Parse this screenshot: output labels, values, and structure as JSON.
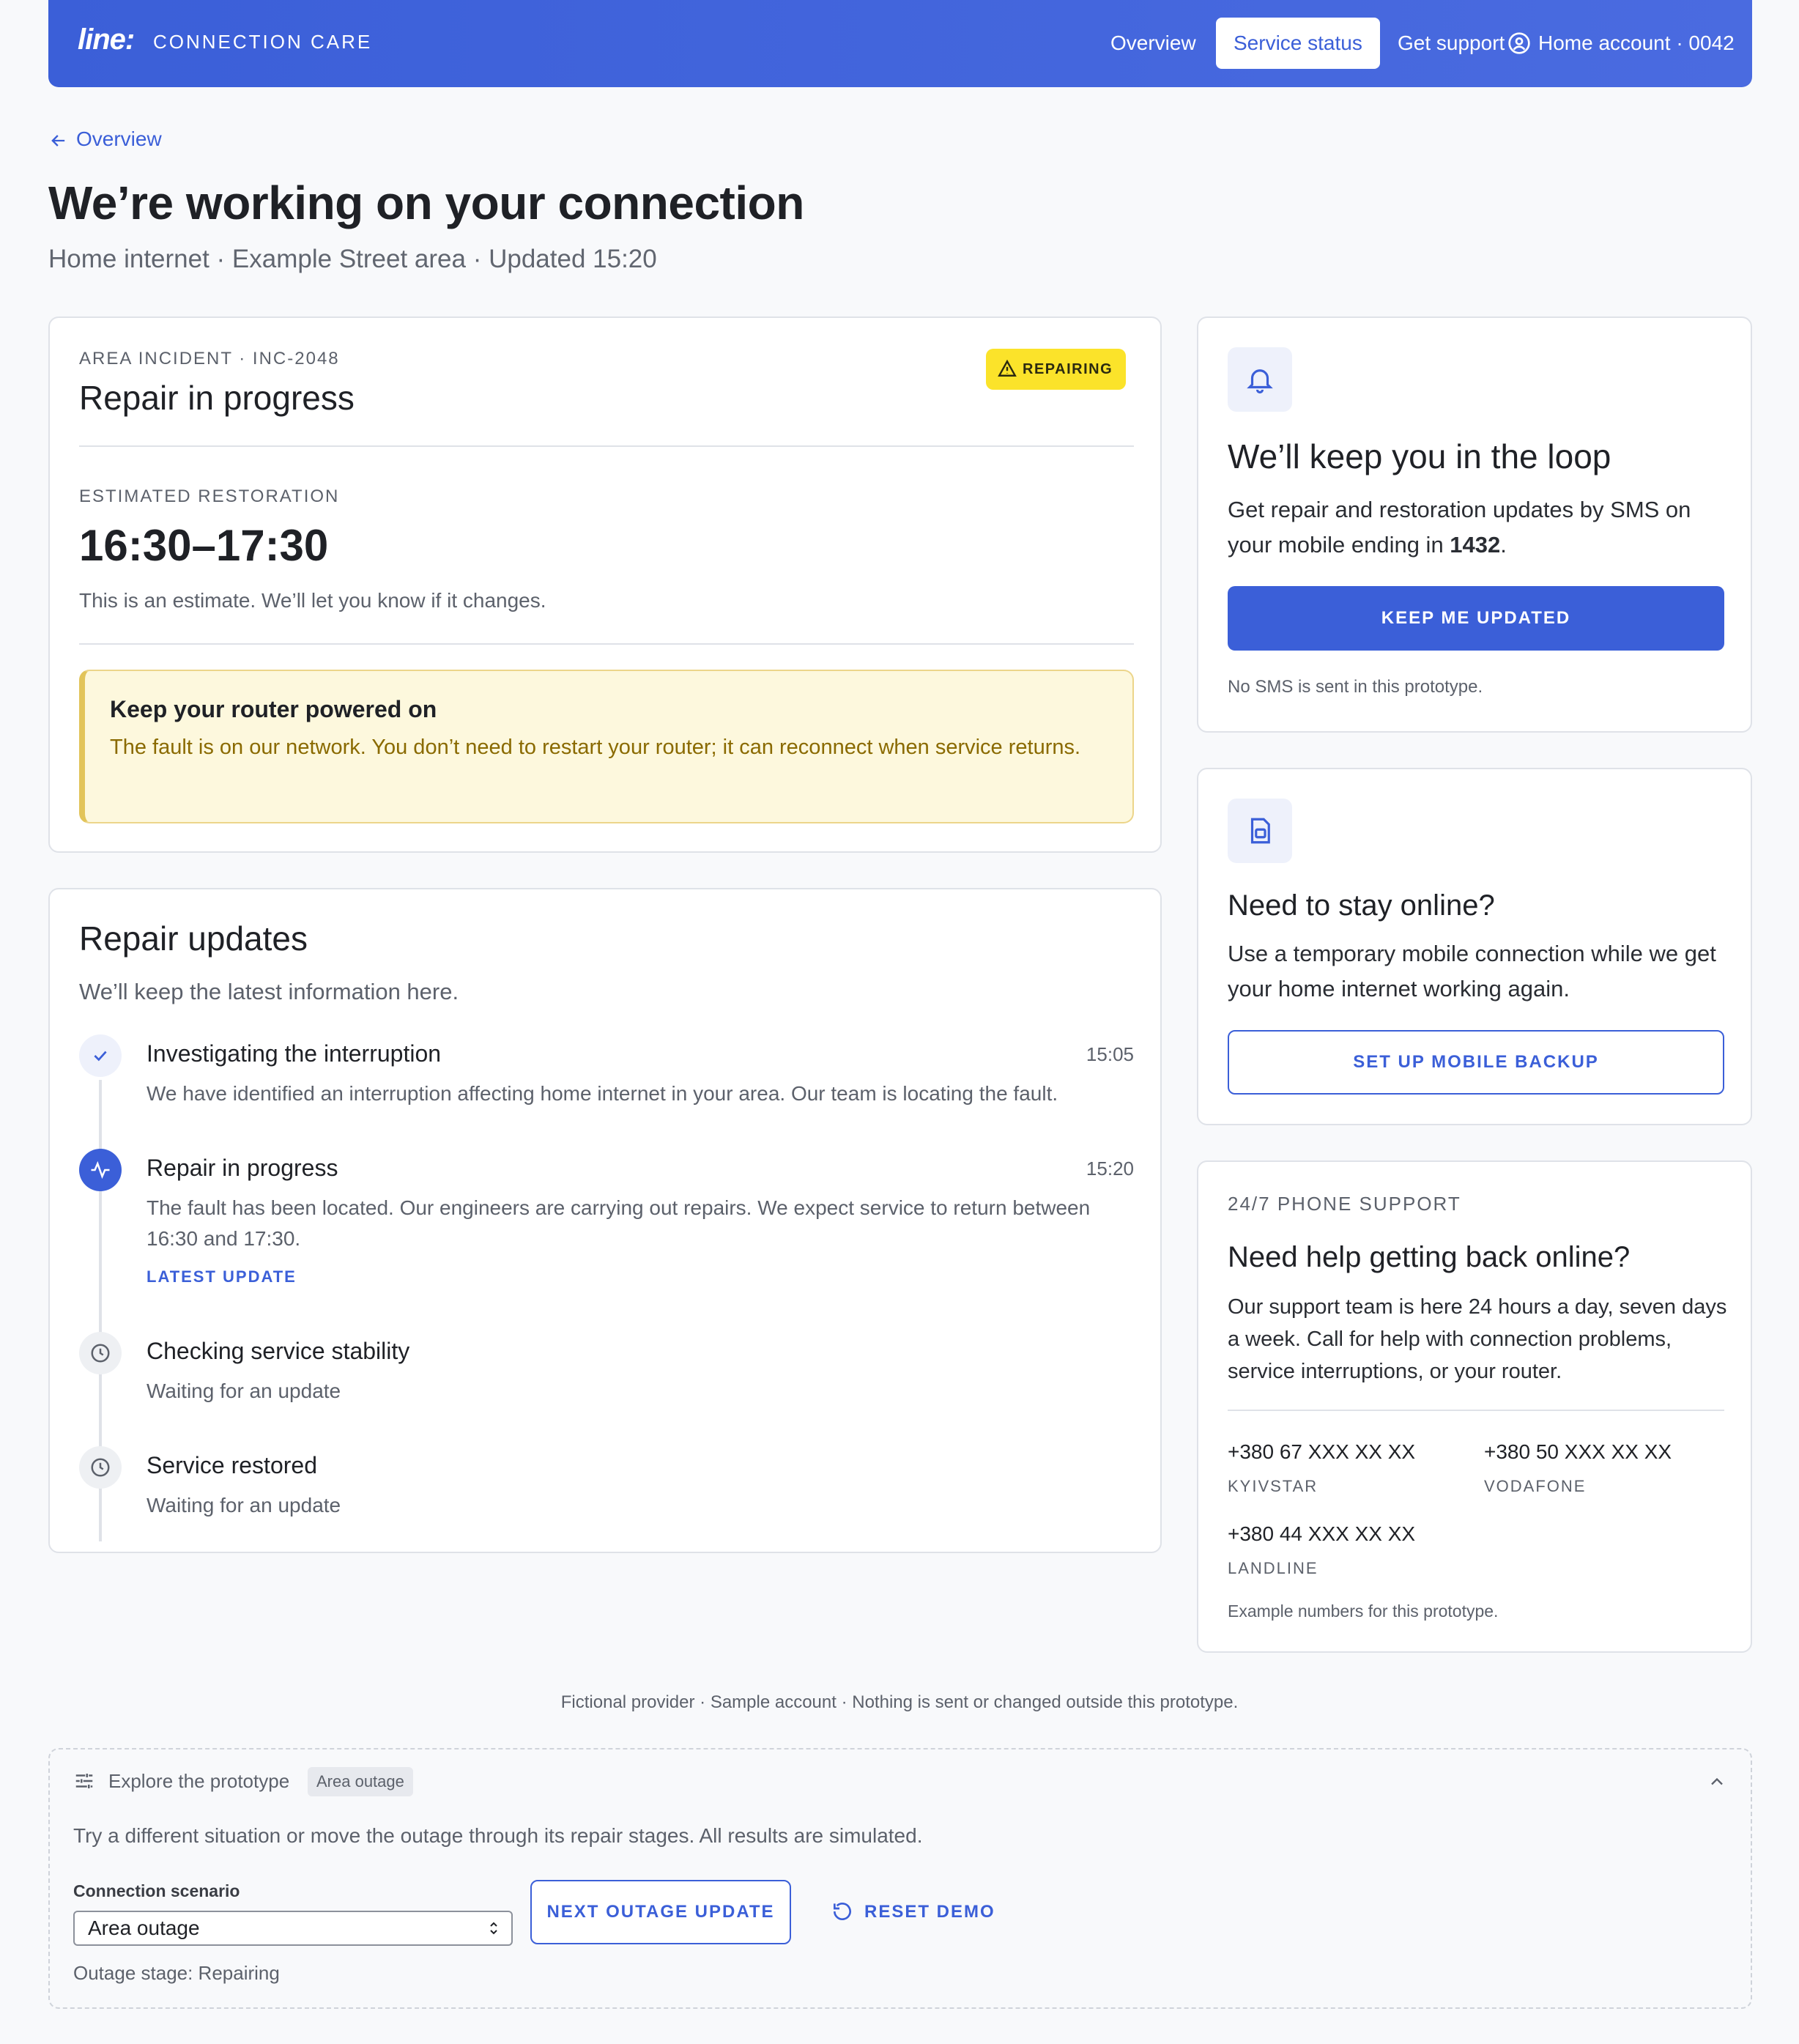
{
  "header": {
    "logo": "line:",
    "brand": "CONNECTION CARE",
    "nav": {
      "overview": "Overview",
      "service_status": "Service status",
      "get_support": "Get support",
      "account": "Home account · 0042"
    }
  },
  "back_link": "Overview",
  "page": {
    "title": "We’re working on your connection",
    "subtitle": "Home internet · Example Street area · Updated 15:20"
  },
  "incident": {
    "eyebrow": "AREA INCIDENT · INC-2048",
    "title": "Repair in progress",
    "badge": "REPAIRING",
    "restoration_label": "ESTIMATED RESTORATION",
    "restoration_time": "16:30–17:30",
    "restoration_note": "This is an estimate. We’ll let you know if it changes.",
    "notice_title": "Keep your router powered on",
    "notice_body": "The fault is on our network. You don’t need to restart your router; it can reconnect when service returns."
  },
  "updates": {
    "title": "Repair updates",
    "subtitle": "We’ll keep the latest information here.",
    "items": [
      {
        "title": "Investigating the interruption",
        "time": "15:05",
        "desc": "We have identified an interruption affecting home internet in your area. Our team is locating the fault."
      },
      {
        "title": "Repair in progress",
        "time": "15:20",
        "desc": "The fault has been located. Our engineers are carrying out repairs. We expect service to return between 16:30 and 17:30.",
        "tag": "LATEST UPDATE"
      },
      {
        "title": "Checking service stability",
        "desc": "Waiting for an update"
      },
      {
        "title": "Service restored",
        "desc": "Waiting for an update"
      }
    ]
  },
  "loop": {
    "title": "We’ll keep you in the loop",
    "body_prefix": "Get repair and restoration updates by SMS on your mobile ending in ",
    "mobile_ending": "1432",
    "body_suffix": ".",
    "button": "KEEP ME UPDATED",
    "note": "No SMS is sent in this prototype."
  },
  "backup": {
    "title": "Need to stay online?",
    "body": "Use a temporary mobile connection while we get your home internet working again.",
    "button": "SET UP MOBILE BACKUP"
  },
  "phone": {
    "eyebrow": "24/7 PHONE SUPPORT",
    "title": "Need help getting back online?",
    "body": "Our support team is here 24 hours a day, seven days a week. Call for help with connection problems, service interruptions, or your router.",
    "numbers": [
      {
        "number": "+380 67 XXX XX XX",
        "label": "KYIVSTAR"
      },
      {
        "number": "+380 50 XXX XX XX",
        "label": "VODAFONE"
      },
      {
        "number": "+380 44 XXX XX XX",
        "label": "LANDLINE"
      }
    ],
    "note": "Example numbers for this prototype."
  },
  "footer": "Fictional provider · Sample account · Nothing is sent or changed outside this prototype.",
  "demo": {
    "title": "Explore the prototype",
    "chip": "Area outage",
    "intro": "Try a different situation or move the outage through its repair stages. All results are simulated.",
    "scenario_label": "Connection scenario",
    "scenario_value": "Area outage",
    "stage": "Outage stage: Repairing",
    "next_button": "NEXT OUTAGE UPDATE",
    "reset_button": "RESET DEMO"
  },
  "colors": {
    "accent": "#3b5fd8",
    "badge_yellow": "#fbe32a",
    "notice_bg": "#fdf8dd",
    "notice_text": "#8a6a00"
  }
}
